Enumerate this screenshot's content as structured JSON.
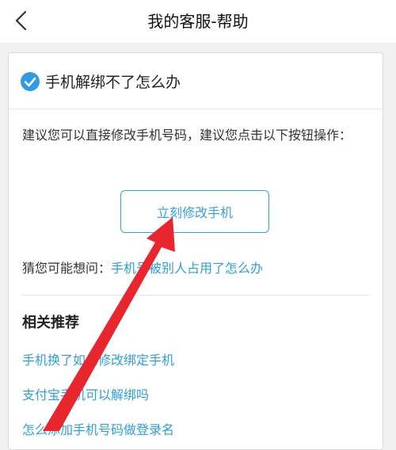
{
  "header": {
    "title": "我的客服-帮助",
    "back_icon": "chevron-left-icon"
  },
  "question": {
    "title": "手机解绑不了怎么办",
    "icon": "check-circle-icon",
    "icon_color": "#2f9be0"
  },
  "advice": "建议您可以直接修改手机号码，建议您点击以下按钮操作：",
  "action_button": {
    "label": "立刻修改手机"
  },
  "guess": {
    "label": "猜您可能想问：",
    "link": "手机号被别人占用了怎么办"
  },
  "related": {
    "heading": "相关推荐",
    "items": [
      "手机换了如何修改绑定手机",
      "支付宝手机可以解绑吗",
      "怎么添加手机号码做登录名"
    ]
  },
  "colors": {
    "link": "#2e9ed8",
    "annotation_arrow": "#e8262d"
  }
}
